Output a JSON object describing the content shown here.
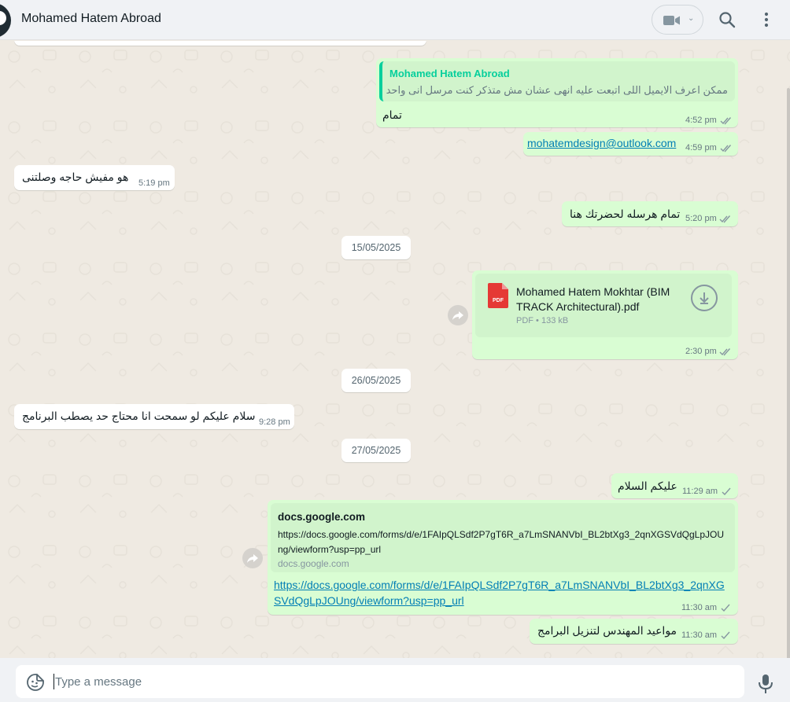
{
  "header": {
    "contact_name": "Mohamed Hatem Abroad"
  },
  "messages": {
    "m1": {
      "quote_author": "Mohamed Hatem Abroad",
      "quote_text": "ممكن اعرف الايميل اللى اتبعت عليه انهى عشان مش متذكر كنت مرسل انى واحد",
      "text": "تمام",
      "time": "4:52 pm"
    },
    "m2": {
      "text": "mohatemdesign@outlook.com",
      "time": "4:59 pm"
    },
    "m3": {
      "text": "هو مفيش حاجه وصلتنى",
      "time": "5:19 pm"
    },
    "m4": {
      "text": "تمام هرسله لحضرتك هنا",
      "time": "5:20 pm"
    },
    "d1": "15/05/2025",
    "m5": {
      "file_name": "Mohamed Hatem Mokhtar (BIM TRACK Architectural).pdf",
      "file_meta": "PDF • 133 kB",
      "pdf_label": "PDF",
      "time": "2:30 pm"
    },
    "d2": "26/05/2025",
    "m6": {
      "text": "سلام عليكم لو سمحت انا محتاج حد يصطب البرنامج",
      "time": "9:28 pm"
    },
    "d3": "27/05/2025",
    "m7": {
      "text": "عليكم السلام",
      "time": "11:29 am"
    },
    "m8": {
      "preview_title": "docs.google.com",
      "preview_desc": "https://docs.google.com/forms/d/e/1FAIpQLSdf2P7gT6R_a7LmSNANVbI_BL2btXg3_2qnXGSVdQgLpJOUng/viewform?usp=pp_url",
      "preview_domain": "docs.google.com",
      "link": "https://docs.google.com/forms/d/e/1FAIpQLSdf2P7gT6R_a7LmSNANVbI_BL2btXg3_2qnXGSVdQgLpJOUng/viewform?usp=pp_url",
      "time": "11:30 am"
    },
    "m9": {
      "text": "مواعيد المهندس لتنزيل البرامج",
      "time": "11:30 am"
    }
  },
  "composer": {
    "placeholder": "Type a message"
  },
  "colors": {
    "outgoing_bubble": "#d9fdd3",
    "incoming_bubble": "#ffffff",
    "accent": "#06cf9c",
    "read_ticks": "#53bdeb",
    "sent_ticks": "#8696a0",
    "link": "#027eb5"
  },
  "icons": [
    "video-call-icon",
    "search-icon",
    "menu-icon",
    "forward-icon",
    "pdf-icon",
    "download-icon",
    "sticker-icon",
    "mic-icon",
    "double-check-icon",
    "single-check-icon"
  ]
}
